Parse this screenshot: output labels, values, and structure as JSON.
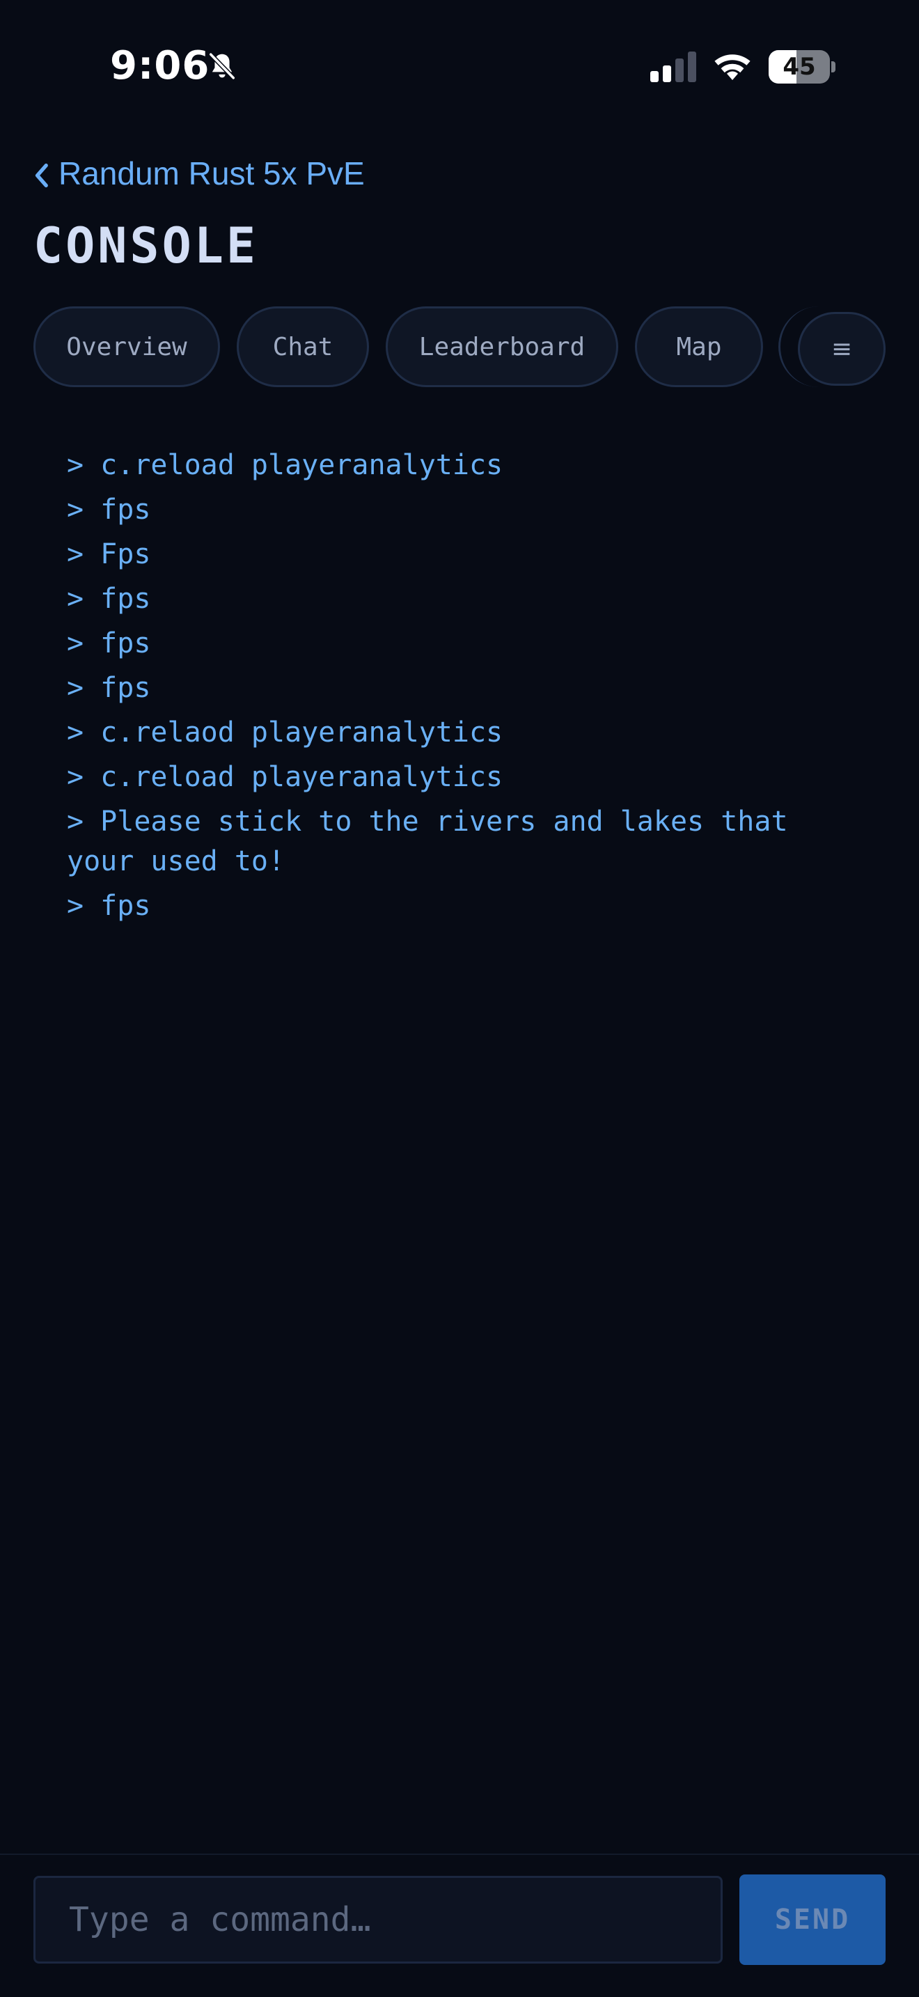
{
  "status_bar": {
    "time": "9:06",
    "battery_level": "45",
    "battery_fraction": 0.45,
    "icons": [
      "bell-slash-icon",
      "signal-icon",
      "wifi-icon",
      "battery-icon"
    ]
  },
  "header": {
    "back_label": "Randum Rust 5x PvE",
    "back_icon": "chevron-left-icon",
    "title": "CONSOLE"
  },
  "tabs": [
    {
      "label": "Overview"
    },
    {
      "label": "Chat"
    },
    {
      "label": "Leaderboard"
    },
    {
      "label": "Map"
    }
  ],
  "menu_button": {
    "label": "≡",
    "icon": "menu-icon"
  },
  "console": {
    "lines": [
      "> c.reload playeranalytics",
      "> fps",
      "> Fps",
      "> fps",
      "> fps",
      "> fps",
      "> c.relaod playeranalytics",
      "> c.reload playeranalytics",
      "> Please stick to the rivers and lakes that your used to!",
      "> fps"
    ]
  },
  "input": {
    "placeholder": "Type a command…",
    "value": ""
  },
  "send_button": {
    "label": "SEND"
  },
  "colors": {
    "background": "#070b15",
    "accent": "#6aaef7",
    "console_text": "#6ab0f5",
    "send_button": "#1d5aa6",
    "tab_border": "#1f2d47"
  }
}
